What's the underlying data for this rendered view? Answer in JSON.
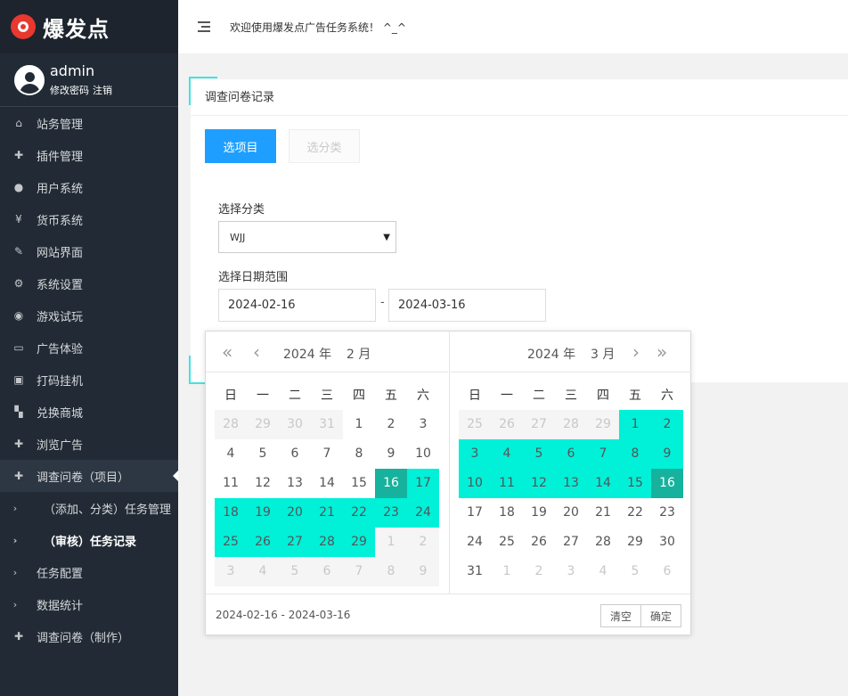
{
  "app": {
    "brand": "爆发点"
  },
  "user": {
    "name": "admin",
    "change_pwd": "修改密码",
    "logout": "注销"
  },
  "nav": [
    {
      "label": "站务管理",
      "icon": "home-icon",
      "glyph": "⌂"
    },
    {
      "label": "插件管理",
      "icon": "puzzle-icon",
      "glyph": "✚"
    },
    {
      "label": "用户系统",
      "icon": "user-icon",
      "glyph": "●"
    },
    {
      "label": "货币系统",
      "icon": "yen-icon",
      "glyph": "¥"
    },
    {
      "label": "网站界面",
      "icon": "brush-icon",
      "glyph": "✎"
    },
    {
      "label": "系统设置",
      "icon": "gears-icon",
      "glyph": "⚙"
    },
    {
      "label": "游戏试玩",
      "icon": "gamepad-icon",
      "glyph": "◉"
    },
    {
      "label": "广告体验",
      "icon": "monitor-icon",
      "glyph": "▭"
    },
    {
      "label": "打码挂机",
      "icon": "image-icon",
      "glyph": "▣"
    },
    {
      "label": "兑换商城",
      "icon": "cart-icon",
      "glyph": "▚"
    },
    {
      "label": "浏览广告",
      "icon": "plus-icon",
      "glyph": "✚"
    },
    {
      "label": "调查问卷（项目）",
      "icon": "plus-icon",
      "glyph": "✚"
    }
  ],
  "subnav": [
    {
      "label": "（添加、分类）任务管理"
    },
    {
      "label": "（审核）任务记录"
    },
    {
      "label": "任务配置"
    },
    {
      "label": "数据统计"
    }
  ],
  "nav_last": {
    "label": "调查问卷（制作）",
    "glyph": "✚"
  },
  "topbar": {
    "welcome": "欢迎使用爆发点广告任务系统！ ^_^"
  },
  "card": {
    "title": "调查问卷记录"
  },
  "buttons": {
    "select_project": "选项目",
    "select_category": "选分类"
  },
  "form": {
    "category_label": "选择分类",
    "category_value": "WJJ",
    "date_label": "选择日期范围",
    "date_start": "2024-02-16",
    "date_sep": "-",
    "date_end": "2024-03-16"
  },
  "calendar": {
    "left": {
      "year": "2024 年",
      "month": "2 月"
    },
    "right": {
      "year": "2024 年",
      "month": "3 月"
    },
    "weekdays": [
      "日",
      "一",
      "二",
      "三",
      "四",
      "五",
      "六"
    ],
    "left_rows": [
      [
        [
          "28",
          "o"
        ],
        [
          "29",
          "o"
        ],
        [
          "30",
          "o"
        ],
        [
          "31",
          "o"
        ],
        [
          "1",
          ""
        ],
        [
          "2",
          ""
        ],
        [
          "3",
          ""
        ]
      ],
      [
        [
          "4",
          ""
        ],
        [
          "5",
          ""
        ],
        [
          "6",
          ""
        ],
        [
          "7",
          ""
        ],
        [
          "8",
          ""
        ],
        [
          "9",
          ""
        ],
        [
          "10",
          ""
        ]
      ],
      [
        [
          "11",
          ""
        ],
        [
          "12",
          ""
        ],
        [
          "13",
          ""
        ],
        [
          "14",
          ""
        ],
        [
          "15",
          ""
        ],
        [
          "16",
          "e"
        ],
        [
          "17",
          "r"
        ]
      ],
      [
        [
          "18",
          "r"
        ],
        [
          "19",
          "r"
        ],
        [
          "20",
          "r"
        ],
        [
          "21",
          "r"
        ],
        [
          "22",
          "r"
        ],
        [
          "23",
          "r"
        ],
        [
          "24",
          "r"
        ]
      ],
      [
        [
          "25",
          "r"
        ],
        [
          "26",
          "r"
        ],
        [
          "27",
          "r"
        ],
        [
          "28",
          "r"
        ],
        [
          "29",
          "r"
        ],
        [
          "1",
          "o"
        ],
        [
          "2",
          "o"
        ]
      ],
      [
        [
          "3",
          "o"
        ],
        [
          "4",
          "o"
        ],
        [
          "5",
          "o"
        ],
        [
          "6",
          "o"
        ],
        [
          "7",
          "o"
        ],
        [
          "8",
          "o"
        ],
        [
          "9",
          "o"
        ]
      ]
    ],
    "right_rows": [
      [
        [
          "25",
          "o"
        ],
        [
          "26",
          "o"
        ],
        [
          "27",
          "o"
        ],
        [
          "28",
          "o"
        ],
        [
          "29",
          "o"
        ],
        [
          "1",
          "r"
        ],
        [
          "2",
          "r"
        ]
      ],
      [
        [
          "3",
          "r"
        ],
        [
          "4",
          "r"
        ],
        [
          "5",
          "r"
        ],
        [
          "6",
          "r"
        ],
        [
          "7",
          "r"
        ],
        [
          "8",
          "r"
        ],
        [
          "9",
          "r"
        ]
      ],
      [
        [
          "10",
          "r"
        ],
        [
          "11",
          "r"
        ],
        [
          "12",
          "r"
        ],
        [
          "13",
          "r"
        ],
        [
          "14",
          "r"
        ],
        [
          "15",
          "r"
        ],
        [
          "16",
          "e"
        ]
      ],
      [
        [
          "17",
          ""
        ],
        [
          "18",
          ""
        ],
        [
          "19",
          ""
        ],
        [
          "20",
          ""
        ],
        [
          "21",
          ""
        ],
        [
          "22",
          ""
        ],
        [
          "23",
          ""
        ]
      ],
      [
        [
          "24",
          ""
        ],
        [
          "25",
          ""
        ],
        [
          "26",
          ""
        ],
        [
          "27",
          ""
        ],
        [
          "28",
          ""
        ],
        [
          "29",
          ""
        ],
        [
          "30",
          ""
        ]
      ],
      [
        [
          "31",
          ""
        ],
        [
          "1",
          "o2"
        ],
        [
          "2",
          "o2"
        ],
        [
          "3",
          "o2"
        ],
        [
          "4",
          "o2"
        ],
        [
          "5",
          "o2"
        ],
        [
          "6",
          "o2"
        ]
      ]
    ],
    "range_text": "2024-02-16 - 2024-03-16",
    "clear": "清空",
    "confirm": "确定"
  }
}
